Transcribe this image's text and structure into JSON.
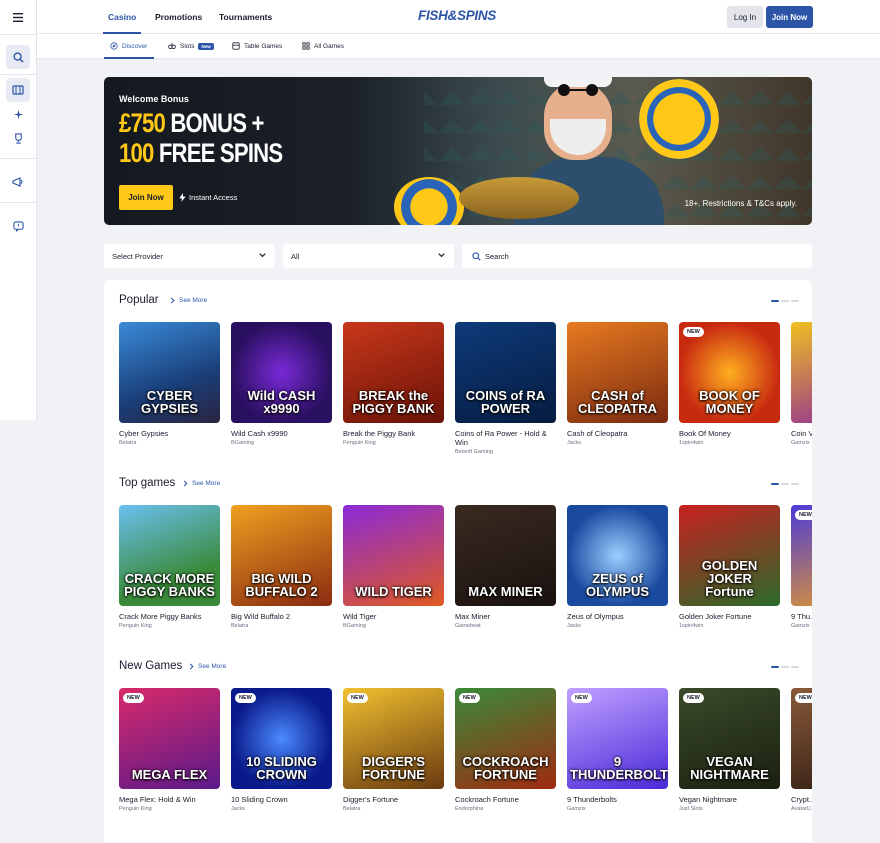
{
  "header": {
    "tabs": [
      {
        "label": "Casino",
        "active": true
      },
      {
        "label": "Promotions"
      },
      {
        "label": "Tournaments"
      }
    ],
    "logo": "FISH&SPINS",
    "login_label": "Log In",
    "join_label": "Join Now"
  },
  "subnav": {
    "items": [
      {
        "label": "Discover",
        "icon": "compass-icon",
        "active": true
      },
      {
        "label": "Slots",
        "icon": "slots-icon",
        "badge": "New"
      },
      {
        "label": "Table Games",
        "icon": "table-icon"
      },
      {
        "label": "All Games",
        "icon": "grid-icon"
      }
    ]
  },
  "sidebar": {
    "icons": [
      "menu-icon",
      "search-icon",
      "casino-icon",
      "sparkle-icon",
      "trophy-icon",
      "promo-icon",
      "chat-icon"
    ]
  },
  "hero": {
    "welcome": "Welcome Bonus",
    "line1_amount": "£750",
    "line1_rest": " BONUS +",
    "line2_amount": "100",
    "line2_rest": " FREE SPINS",
    "cta": "Join Now",
    "instant": "Instant Access",
    "terms": "18+. Restrictions & T&Cs apply."
  },
  "filters": {
    "provider_label": "Select Provider",
    "category_label": "All",
    "search_placeholder": "Search"
  },
  "colors": {
    "brand": "#2c55a8",
    "accent_yellow": "#ffc817"
  },
  "sections": [
    {
      "title": "Popular",
      "see_more": "See More",
      "games": [
        {
          "name": "Cyber Gypsies",
          "provider": "Belatra",
          "art": "CYBER GYPSIES",
          "bg": "linear-gradient(160deg,#3a8bd8,#1a3f7a 60%,#2a2440)"
        },
        {
          "name": "Wild Cash x9990",
          "provider": "BGaming",
          "art": "Wild CASH x9990",
          "bg": "radial-gradient(circle,#7a2ad8,#2a1060 70%)"
        },
        {
          "name": "Break the Piggy Bank",
          "provider": "Penguin King",
          "art": "BREAK the PIGGY BANK",
          "bg": "linear-gradient(160deg,#c8381a,#6a1208)"
        },
        {
          "name": "Coins of Ra Power - Hold & Win",
          "provider": "Betsoft Gaming",
          "art": "COINS of RA POWER",
          "bg": "linear-gradient(160deg,#0e3a7a,#061c40)"
        },
        {
          "name": "Cash of Cleopatra",
          "provider": "Jacks",
          "art": "CASH of CLEOPATRA",
          "bg": "linear-gradient(160deg,#e87a20,#7a2a10)"
        },
        {
          "name": "Book Of Money",
          "provider": "1spin4win",
          "art": "BOOK OF MONEY",
          "bg": "radial-gradient(circle,#ffb020,#c82a10 70%)",
          "new": true
        },
        {
          "name": "Coin V...",
          "provider": "Gamzix",
          "art": "",
          "bg": "linear-gradient(160deg,#f0c020,#8a20a0)"
        }
      ]
    },
    {
      "title": "Top games",
      "see_more": "See More",
      "games": [
        {
          "name": "Crack More Piggy Banks",
          "provider": "Penguin King",
          "art": "CRACK MORE PIGGY BANKS",
          "bg": "linear-gradient(160deg,#6ac0f0,#3a8a3a 70%)"
        },
        {
          "name": "Big Wild Buffalo 2",
          "provider": "Belatra",
          "art": "BIG WILD BUFFALO 2",
          "bg": "linear-gradient(160deg,#f0a020,#8a2a10)"
        },
        {
          "name": "Wild Tiger",
          "provider": "BGaming",
          "art": "WILD TIGER",
          "bg": "linear-gradient(160deg,#8a2ad8,#e05a20)"
        },
        {
          "name": "Max Miner",
          "provider": "Gamebeat",
          "art": "MAX MINER",
          "bg": "linear-gradient(160deg,#3a2a20,#1a1210)"
        },
        {
          "name": "Zeus of Olympus",
          "provider": "Jacks",
          "art": "ZEUS of OLYMPUS",
          "bg": "radial-gradient(circle,#9ad0ff,#1a4aa0 70%)"
        },
        {
          "name": "Golden Joker Fortune",
          "provider": "1spin4win",
          "art": "GOLDEN JOKER Fortune",
          "bg": "linear-gradient(160deg,#c82020,#2a6a2a)"
        },
        {
          "name": "9 Thu...",
          "provider": "Gamzix",
          "art": "",
          "bg": "linear-gradient(160deg,#4a3ad8,#f0a020)",
          "new": true
        }
      ]
    },
    {
      "title": "New Games",
      "see_more": "See More",
      "games": [
        {
          "name": "Mega Flex: Hold & Win",
          "provider": "Penguin King",
          "art": "MEGA FLEX",
          "bg": "linear-gradient(160deg,#d82a6a,#5a1a8a)",
          "new": true
        },
        {
          "name": "10 Sliding Crown",
          "provider": "Jacks",
          "art": "10 SLIDING CROWN",
          "bg": "radial-gradient(circle,#4a8aff,#0a1a8a 70%)",
          "new": true
        },
        {
          "name": "Digger's Fortune",
          "provider": "Belatra",
          "art": "DIGGER'S FORTUNE",
          "bg": "linear-gradient(160deg,#f0c030,#6a3a10)",
          "new": true
        },
        {
          "name": "Cockroach Fortune",
          "provider": "Endorphina",
          "art": "COCKROACH FORTUNE",
          "bg": "linear-gradient(160deg,#3a8a3a,#a02a10)",
          "new": true
        },
        {
          "name": "9 Thunderbolts",
          "provider": "Gamzix",
          "art": "9 THUNDERBOLTS",
          "bg": "linear-gradient(160deg,#c0a0ff,#4a2ad8)",
          "new": true
        },
        {
          "name": "Vegan Nightmare",
          "provider": "Just Slots",
          "art": "VEGAN NIGHTMARE",
          "bg": "linear-gradient(160deg,#3a4a2a,#1a2010)",
          "new": true
        },
        {
          "name": "Crypt...",
          "provider": "AvatarU...",
          "art": "",
          "bg": "linear-gradient(160deg,#8a5a3a,#2a1a10)",
          "new": true
        }
      ]
    }
  ]
}
